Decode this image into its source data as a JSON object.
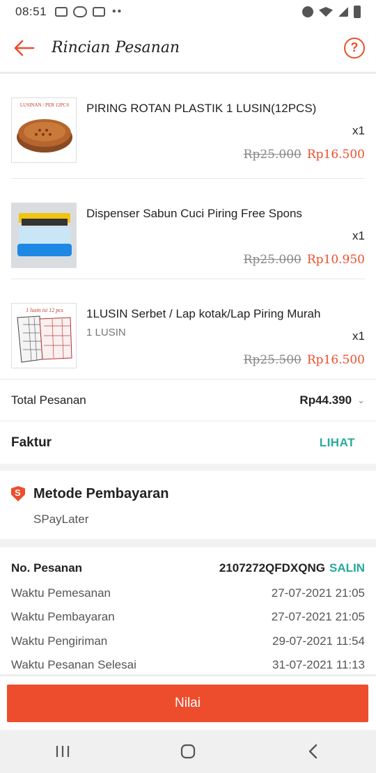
{
  "status": {
    "time": "08:51",
    "icons": [
      "image-icon",
      "line-icon",
      "app-icon",
      "alarm-icon",
      "wifi-icon",
      "signal-icon",
      "battery-icon"
    ]
  },
  "header": {
    "title": "Rincian Pesanan",
    "back_icon": "arrow-left-icon",
    "help_icon": "help-icon"
  },
  "items": [
    {
      "name": "PIRING ROTAN PLASTIK 1 LUSIN(12PCS)",
      "variant": "",
      "qty": "x1",
      "old_price": "Rp25.000",
      "price": "Rp16.500",
      "thumb_text": "LUSINAN / PER 12PCS"
    },
    {
      "name": "Dispenser Sabun Cuci Piring Free Spons",
      "variant": "",
      "qty": "x1",
      "old_price": "Rp25.000",
      "price": "Rp10.950",
      "thumb_text": ""
    },
    {
      "name": "1LUSIN Serbet / Lap kotak/Lap Piring Murah",
      "variant": "1 LUSIN",
      "qty": "x1",
      "old_price": "Rp25.500",
      "price": "Rp16.500",
      "thumb_text": "1 lusin isi 12 pcs"
    }
  ],
  "total": {
    "label": "Total Pesanan",
    "amount": "Rp44.390"
  },
  "faktur": {
    "label": "Faktur",
    "link": "LIHAT"
  },
  "payment": {
    "label": "Metode Pembayaran",
    "method": "SPayLater"
  },
  "order": {
    "no_label": "No. Pesanan",
    "no_value": "2107272QFDXQNG",
    "copy": "SALIN",
    "rows": [
      {
        "label": "Waktu Pemesanan",
        "value": "27-07-2021 21:05"
      },
      {
        "label": "Waktu Pembayaran",
        "value": "27-07-2021 21:05"
      },
      {
        "label": "Waktu Pengiriman",
        "value": "29-07-2021 11:54"
      },
      {
        "label": "Waktu Pesanan Selesai",
        "value": "31-07-2021 11:13"
      }
    ]
  },
  "action": {
    "label": "Nilai"
  },
  "colors": {
    "accent": "#ee4d2d",
    "link": "#26aa99"
  }
}
